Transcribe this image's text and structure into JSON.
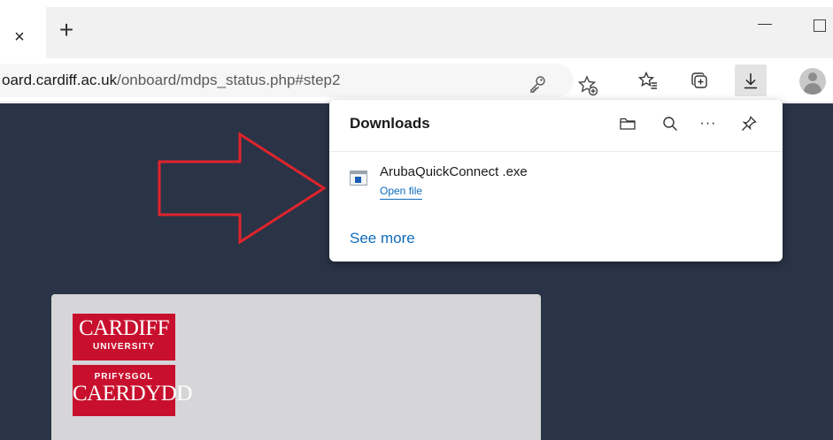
{
  "browser": {
    "tab_close_glyph": "×",
    "new_tab_glyph": "+",
    "url_host": "oard.cardiff.ac.uk",
    "url_path": "/onboard/mdps_status.php#step2",
    "icons": {
      "key": "key-icon",
      "add_favorite": "add-favorite-icon",
      "favorites": "favorites-icon",
      "collections": "collections-icon",
      "downloads": "download-icon",
      "profile": "profile-avatar"
    }
  },
  "downloads": {
    "title": "Downloads",
    "more_glyph": "···",
    "file_name": "ArubaQuickConnect .exe",
    "open_label": "Open file",
    "see_more": "See more"
  },
  "page": {
    "background": "#2b3347",
    "card_color": "#d6d6d8",
    "logo": {
      "line1": "CARDIFF",
      "line2": "UNIVERSITY",
      "line3": "PRIFYSGOL",
      "line4": "CAERDYDD",
      "color": "#c8102e"
    },
    "annotation_arrow_color": "#e0242c"
  }
}
